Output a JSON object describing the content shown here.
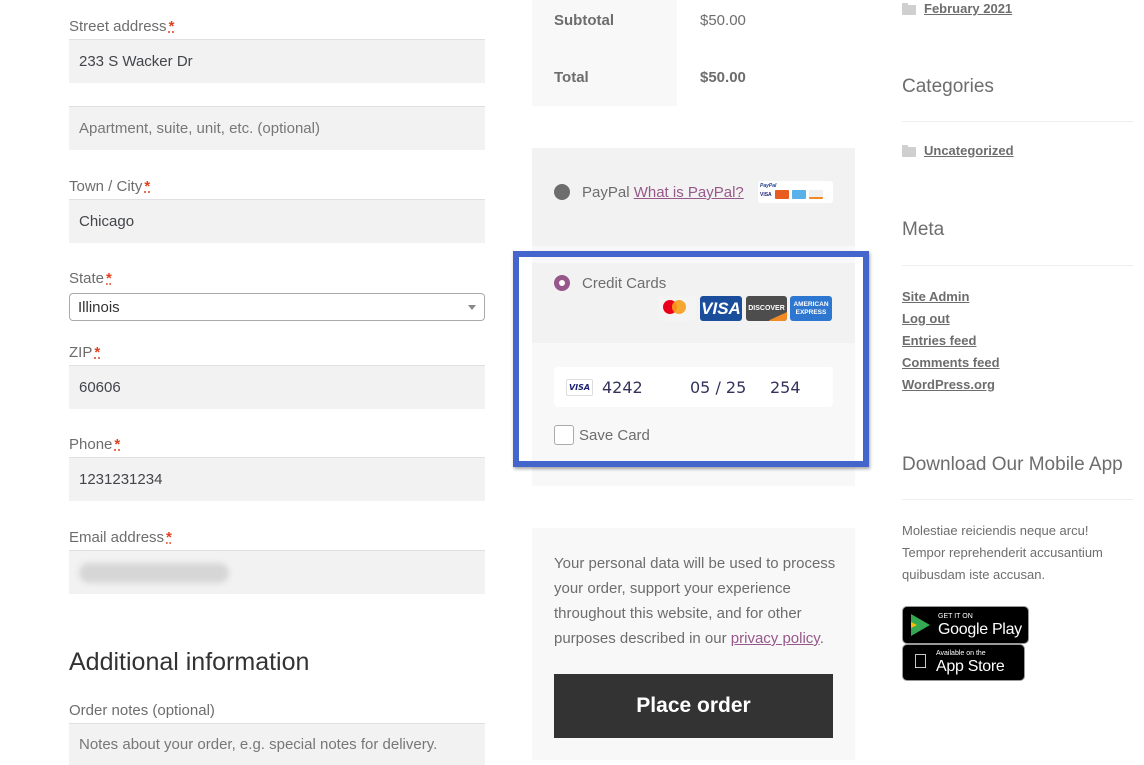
{
  "billing": {
    "street": {
      "label": "Street address",
      "required": "*",
      "value": "233 S Wacker Dr"
    },
    "street2": {
      "placeholder": "Apartment, suite, unit, etc. (optional)"
    },
    "city": {
      "label": "Town / City",
      "required": "*",
      "value": "Chicago"
    },
    "state": {
      "label": "State",
      "required": "*",
      "value": "Illinois"
    },
    "zip": {
      "label": "ZIP",
      "required": "*",
      "value": "60606"
    },
    "phone": {
      "label": "Phone",
      "required": "*",
      "value": "1231231234"
    },
    "email": {
      "label": "Email address",
      "required": "*",
      "value": "[redacted/blurred]"
    }
  },
  "additional": {
    "title": "Additional information",
    "notes": {
      "label": "Order notes (optional)",
      "placeholder": "Notes about your order, e.g. special notes for delivery."
    }
  },
  "totals": {
    "subtotal_label": "Subtotal",
    "subtotal_value": "$50.00",
    "total_label": "Total",
    "total_value": "$50.00"
  },
  "payment": {
    "paypal": {
      "label": "PayPal",
      "link": "What is PayPal?",
      "selected": false,
      "logo_brand": "PayPal",
      "logos": [
        "VISA",
        "Mastercard",
        "Amex",
        "Discover"
      ]
    },
    "credit_cards": {
      "label": "Credit Cards",
      "selected": true,
      "logos": {
        "mastercard": "mastercard",
        "visa": "VISA",
        "discover": "DISCOVER",
        "amex_line1": "AMERICAN",
        "amex_line2": "EXPRESS"
      },
      "card_brand": "VISA",
      "card_number": "4242",
      "expiry": "05 / 25",
      "cvc": "254",
      "save_card_label": "Save Card",
      "save_card_checked": false
    },
    "highlight_color": "#4466cc"
  },
  "privacy": {
    "text_before": "Your personal data will be used to process your order, support your experience throughout this website, and for other purposes described in our ",
    "link": "privacy policy",
    "text_after": "."
  },
  "place_order_label": "Place order",
  "sidebar": {
    "archives": [
      {
        "label": "February 2021"
      }
    ],
    "categories_title": "Categories",
    "categories": [
      {
        "label": "Uncategorized"
      }
    ],
    "meta_title": "Meta",
    "meta_links": [
      "Site Admin",
      "Log out",
      "Entries feed",
      "Comments feed",
      "WordPress.org"
    ],
    "app_title": "Download Our Mobile App",
    "app_text": "Molestiae reiciendis neque arcu! Tempor reprehenderit accusantium quibusdam iste accusan.",
    "google_play": {
      "small": "GET IT ON",
      "big": "Google Play"
    },
    "app_store": {
      "small": "Available on the",
      "big": "App Store"
    }
  },
  "colors": {
    "accent": "#96588a",
    "required": "#e2401c",
    "button_bg": "#333333",
    "input_bg": "#f2f2f2"
  }
}
